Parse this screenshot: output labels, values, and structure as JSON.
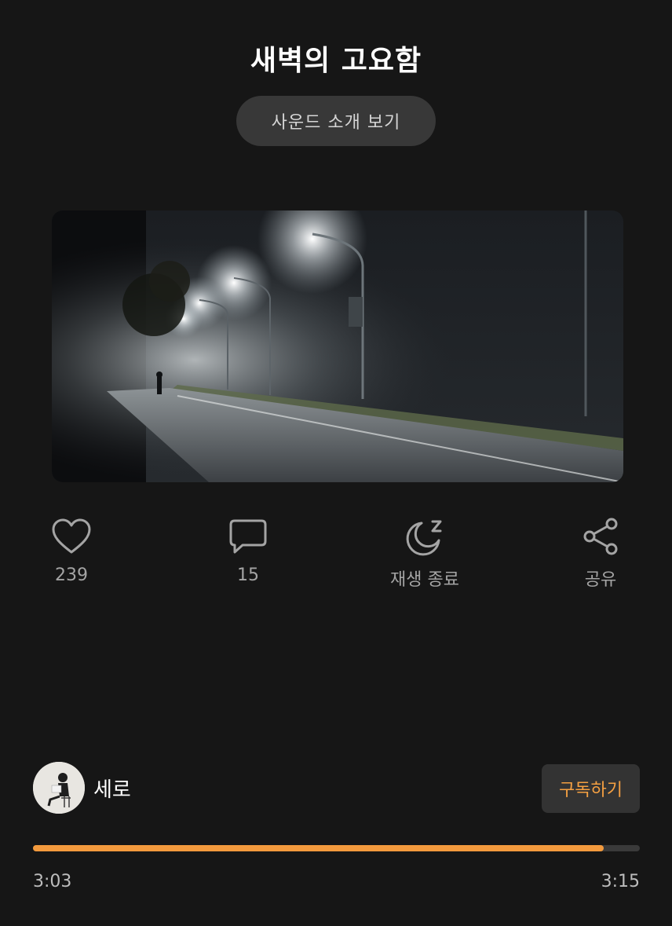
{
  "track": {
    "title": "새벽의 고요함",
    "intro_button": "사운드 소개 보기"
  },
  "artwork": {
    "description_icon": "foggy-road-night-image"
  },
  "actions": {
    "like": {
      "icon": "heart-icon",
      "count": "239"
    },
    "comment": {
      "icon": "speech-bubble-icon",
      "count": "15"
    },
    "sleep_timer": {
      "icon": "moon-zz-icon",
      "label": "재생 종료"
    },
    "share": {
      "icon": "share-icon",
      "label": "공유"
    }
  },
  "creator": {
    "name": "세로",
    "subscribe_label": "구독하기"
  },
  "player": {
    "current_time": "3:03",
    "total_time": "3:15",
    "progress_fraction": 0.94
  },
  "colors": {
    "background": "#161616",
    "accent": "#f39a3d",
    "subscribe_text": "#f5a042"
  }
}
